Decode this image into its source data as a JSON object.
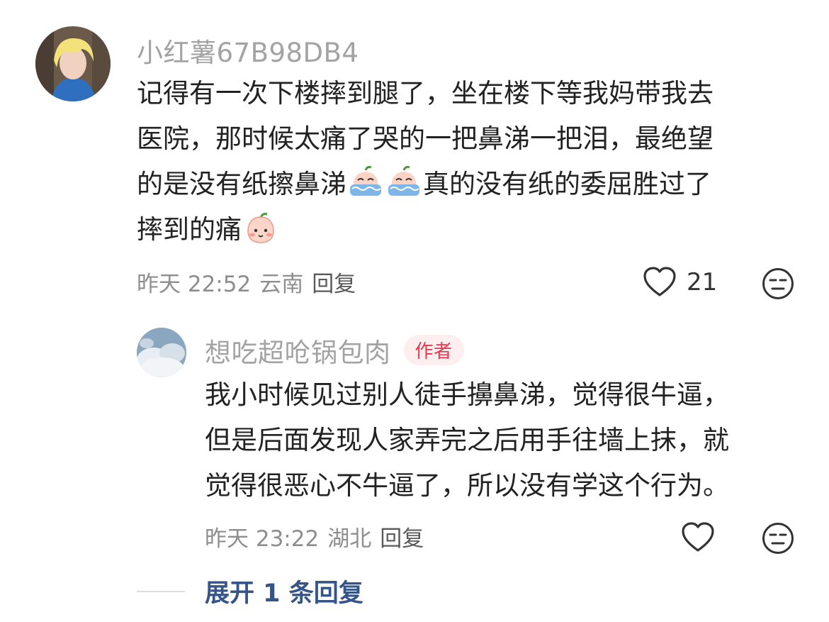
{
  "comment": {
    "username": "小红薯67B98DB4",
    "lines": [
      "记得有一次下楼摔到腿了，坐在楼下等我妈带我去",
      "医院，那时候太痛了哭的一把鼻涕一把泪，最绝望",
      "的是没有纸擦鼻涕",
      "真的没有纸的委屈胜过了",
      "摔到的痛"
    ],
    "time": "昨天 22:52",
    "location": "云南",
    "reply_label": "回复",
    "like_count": "21",
    "emojis": [
      "crying-peach-emoji",
      "crying-peach-emoji",
      "shy-peach-emoji"
    ]
  },
  "reply": {
    "username": "想吃超呛锅包肉",
    "badge": "作者",
    "lines": [
      "我小时候见过别人徒手擤鼻涕，觉得很牛逼，",
      "但是后面发现人家弄完之后用手往墙上抹，就",
      "觉得很恶心不牛逼了，所以没有学这个行为。"
    ],
    "time": "昨天 23:22",
    "location": "湖北",
    "reply_label": "回复"
  },
  "expand": {
    "label": "展开 1 条回复"
  },
  "colors": {
    "accent_link": "#34548a",
    "badge_bg": "#fdeff0",
    "badge_text": "#e8384f",
    "meta_text": "#8e8e8e",
    "username_text": "#a3a3a3"
  }
}
